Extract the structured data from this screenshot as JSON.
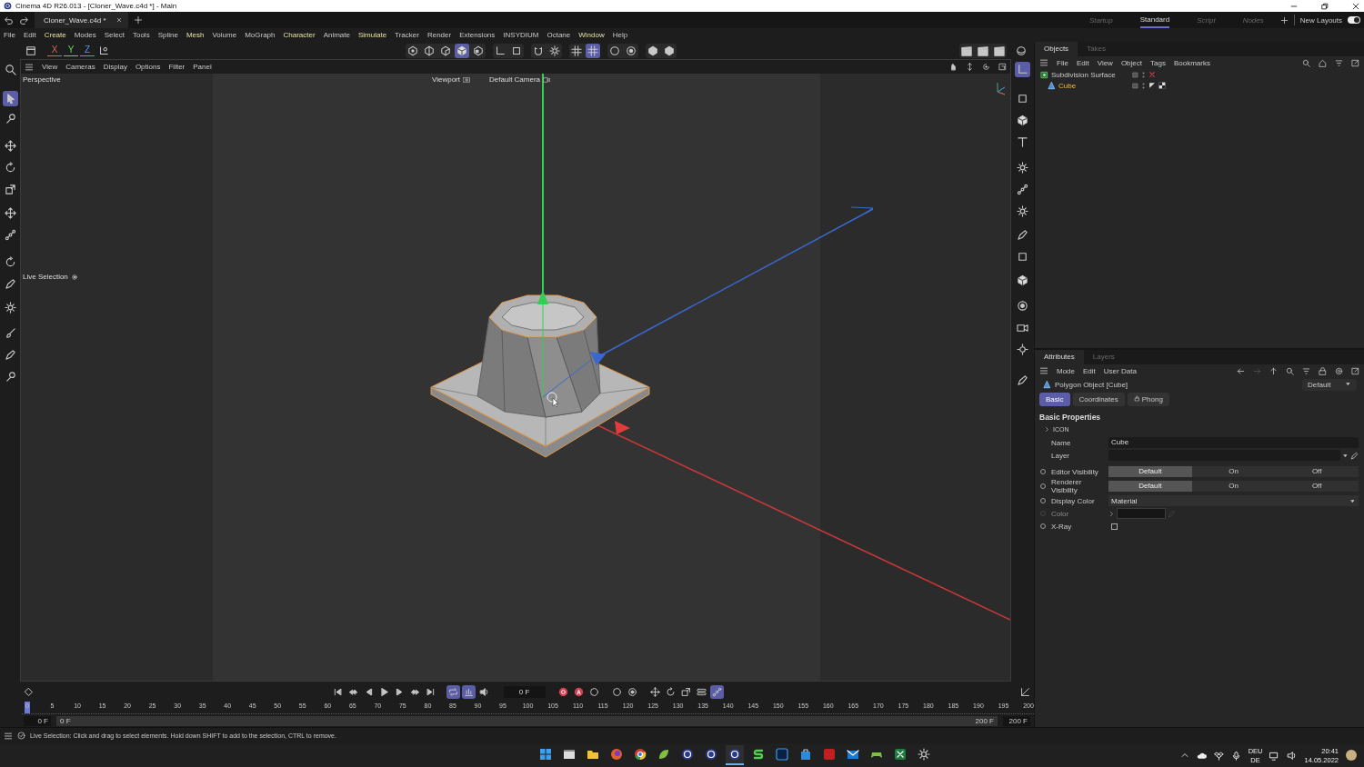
{
  "window": {
    "title": "Cinema 4D R26.013 - [Cloner_Wave.c4d *] - Main"
  },
  "document_tab": {
    "label": "Cloner_Wave.c4d *"
  },
  "layouts": [
    {
      "label": "Startup",
      "selected": false
    },
    {
      "label": "Standard",
      "selected": true
    },
    {
      "label": "Script",
      "selected": false
    },
    {
      "label": "Nodes",
      "selected": false
    }
  ],
  "new_layouts": {
    "label": "New Layouts",
    "on": true
  },
  "menu": [
    {
      "label": "File",
      "highlight": false
    },
    {
      "label": "Edit",
      "highlight": false
    },
    {
      "label": "Create",
      "highlight": true
    },
    {
      "label": "Modes",
      "highlight": false
    },
    {
      "label": "Select",
      "highlight": false
    },
    {
      "label": "Tools",
      "highlight": false
    },
    {
      "label": "Spline",
      "highlight": false
    },
    {
      "label": "Mesh",
      "highlight": true
    },
    {
      "label": "Volume",
      "highlight": false
    },
    {
      "label": "MoGraph",
      "highlight": false
    },
    {
      "label": "Character",
      "highlight": true
    },
    {
      "label": "Animate",
      "highlight": false
    },
    {
      "label": "Simulate",
      "highlight": true
    },
    {
      "label": "Tracker",
      "highlight": false
    },
    {
      "label": "Render",
      "highlight": false
    },
    {
      "label": "Extensions",
      "highlight": false
    },
    {
      "label": "INSYDIUM",
      "highlight": false
    },
    {
      "label": "Octane",
      "highlight": false
    },
    {
      "label": "Window",
      "highlight": true
    },
    {
      "label": "Help",
      "highlight": false
    }
  ],
  "axis_lock": [
    {
      "label": "X",
      "color": "#e06060"
    },
    {
      "label": "Y",
      "color": "#60d060"
    },
    {
      "label": "Z",
      "color": "#6090e8"
    }
  ],
  "toolbar": [
    {
      "kind": "point",
      "selected": false
    },
    {
      "kind": "edge",
      "selected": false
    },
    {
      "kind": "poly",
      "selected": false
    },
    {
      "kind": "cube",
      "selected": true
    },
    {
      "kind": "checker",
      "selected": false
    },
    {
      "kind": "corner",
      "selected": false
    },
    {
      "kind": "square",
      "selected": false
    },
    {
      "kind": "magnet",
      "selected": false
    },
    {
      "kind": "gear",
      "selected": false
    },
    {
      "kind": "grid",
      "selected": false
    },
    {
      "kind": "grid",
      "selected": true
    },
    {
      "kind": "dot",
      "selected": false
    },
    {
      "kind": "target",
      "selected": false
    },
    {
      "kind": "hexagon",
      "selected": false
    },
    {
      "kind": "hexagon",
      "selected": false
    }
  ],
  "left_tools": [
    {
      "kind": "search",
      "selected": false
    },
    {
      "kind": "cursor",
      "selected": true
    },
    {
      "kind": "tweak",
      "selected": false
    },
    {
      "kind": "move",
      "selected": false
    },
    {
      "kind": "rotate",
      "selected": false
    },
    {
      "kind": "scale",
      "selected": false
    },
    {
      "kind": "move",
      "selected": false
    },
    {
      "kind": "nodes",
      "selected": false
    },
    {
      "kind": "rotate",
      "selected": false
    },
    {
      "kind": "pen",
      "selected": false
    },
    {
      "kind": "gear",
      "selected": false
    },
    {
      "kind": "brush",
      "selected": false
    },
    {
      "kind": "pen",
      "selected": false
    },
    {
      "kind": "tweak",
      "selected": false
    }
  ],
  "right_palette": [
    {
      "kind": "corner",
      "selected": true
    },
    {
      "kind": "square",
      "selected": false
    },
    {
      "kind": "cube",
      "selected": false
    },
    {
      "kind": "text",
      "selected": false
    },
    {
      "kind": "gear",
      "selected": false
    },
    {
      "kind": "nodes",
      "selected": false
    },
    {
      "kind": "gear",
      "selected": false
    },
    {
      "kind": "pen",
      "selected": false
    },
    {
      "kind": "square",
      "selected": false
    },
    {
      "kind": "cube",
      "selected": false
    },
    {
      "kind": "target",
      "selected": false
    },
    {
      "kind": "camera",
      "selected": false
    },
    {
      "kind": "sun",
      "selected": false
    },
    {
      "kind": "pen",
      "selected": false
    }
  ],
  "viewport": {
    "menu": [
      "View",
      "Cameras",
      "Display",
      "Options",
      "Filter",
      "Panel"
    ],
    "view_name": "Perspective",
    "viewport_label": "Viewport",
    "camera": "Default Camera",
    "tool_label": "Live Selection"
  },
  "objects": {
    "tabs": [
      {
        "label": "Objects",
        "selected": true
      },
      {
        "label": "Takes",
        "selected": false
      }
    ],
    "menu": [
      "File",
      "Edit",
      "View",
      "Object",
      "Tags",
      "Bookmarks"
    ],
    "items": [
      {
        "name": "Subdivision Surface",
        "kind": "generator",
        "enabled": false,
        "selected": false,
        "children": [
          {
            "name": "Cube",
            "kind": "polygon",
            "enabled": true,
            "selected": true
          }
        ]
      }
    ]
  },
  "attributes": {
    "tabs": [
      {
        "label": "Attributes",
        "selected": true
      },
      {
        "label": "Layers",
        "selected": false
      }
    ],
    "menu": [
      "Mode",
      "Edit",
      "User Data"
    ],
    "object_title": "Polygon Object [Cube]",
    "preset": "Default",
    "subtabs": [
      {
        "label": "Basic",
        "selected": true
      },
      {
        "label": "Coordinates",
        "selected": false
      },
      {
        "label": "Phong",
        "selected": false
      }
    ],
    "section": "Basic Properties",
    "group": {
      "label": "ICON",
      "expanded": false
    },
    "fields": [
      {
        "label": "Name",
        "kind": "text",
        "value": "Cube",
        "animatable": false,
        "disabled": false
      },
      {
        "label": "Layer",
        "kind": "link",
        "animatable": false,
        "disabled": false
      },
      {
        "label": "Editor Visibility",
        "kind": "segmented",
        "animatable": true,
        "disabled": false,
        "options": [
          {
            "label": "Default",
            "selected": true
          },
          {
            "label": "On",
            "selected": false
          },
          {
            "label": "Off",
            "selected": false
          }
        ]
      },
      {
        "label": "Renderer Visibility",
        "kind": "segmented",
        "animatable": true,
        "disabled": false,
        "options": [
          {
            "label": "Default",
            "selected": true
          },
          {
            "label": "On",
            "selected": false
          },
          {
            "label": "Off",
            "selected": false
          }
        ]
      },
      {
        "label": "Display Color",
        "kind": "dropdown",
        "value": "Material",
        "animatable": true,
        "disabled": false
      },
      {
        "label": "Color",
        "kind": "color",
        "animatable": true,
        "disabled": true
      },
      {
        "label": "X-Ray",
        "kind": "checkbox",
        "checked": false,
        "animatable": true,
        "disabled": false
      }
    ]
  },
  "timeline": {
    "current_frame": "0 F",
    "playhead": {
      "level": 0
    },
    "buttons": [
      {
        "kind": "first",
        "selected": false
      },
      {
        "kind": "prevkey",
        "selected": false
      },
      {
        "kind": "prev",
        "selected": false
      },
      {
        "kind": "play",
        "selected": false
      },
      {
        "kind": "next",
        "selected": false
      },
      {
        "kind": "nextkey",
        "selected": false
      },
      {
        "kind": "last",
        "selected": false
      },
      {
        "kind": "loop",
        "selected": true
      },
      {
        "kind": "auto",
        "selected": true
      },
      {
        "kind": "sound",
        "selected": false
      }
    ],
    "key_buttons": [
      {
        "kind": "record",
        "selected": false
      },
      {
        "kind": "autokey",
        "selected": false
      },
      {
        "kind": "dot",
        "selected": false
      },
      {
        "kind": "dot",
        "selected": false
      },
      {
        "kind": "target",
        "selected": false
      },
      {
        "kind": "move",
        "selected": false
      },
      {
        "kind": "rotate",
        "selected": false
      },
      {
        "kind": "scale",
        "selected": false
      },
      {
        "kind": "toggle",
        "selected": false
      },
      {
        "kind": "nodes",
        "selected": true
      }
    ],
    "ruler_labels": [
      "0",
      "5",
      "10",
      "15",
      "20",
      "25",
      "30",
      "35",
      "40",
      "45",
      "50",
      "55",
      "60",
      "65",
      "70",
      "75",
      "80",
      "85",
      "90",
      "95",
      "100",
      "105",
      "110",
      "115",
      "120",
      "125",
      "130",
      "135",
      "140",
      "145",
      "150",
      "155",
      "160",
      "165",
      "170",
      "175",
      "180",
      "185",
      "190",
      "195",
      "200"
    ],
    "start": "0 F",
    "range_start": "0 F",
    "range_end": "200 F",
    "end": "200 F"
  },
  "status": "Live Selection: Click and drag to select elements. Hold down SHIFT to add to the selection, CTRL to remove.",
  "taskbar": {
    "apps": [
      {
        "kind": "start",
        "selected": false
      },
      {
        "kind": "window",
        "selected": false
      },
      {
        "kind": "folder",
        "selected": false
      },
      {
        "kind": "fox",
        "selected": false
      },
      {
        "kind": "chrome",
        "selected": false
      },
      {
        "kind": "leaf",
        "selected": false
      },
      {
        "kind": "ring",
        "selected": false
      },
      {
        "kind": "ring",
        "selected": false
      },
      {
        "kind": "ring",
        "selected": true
      },
      {
        "kind": "s",
        "selected": false
      },
      {
        "kind": "ps",
        "selected": false
      },
      {
        "kind": "store",
        "selected": false
      },
      {
        "kind": "acro",
        "selected": false
      },
      {
        "kind": "mail",
        "selected": false
      },
      {
        "kind": "game",
        "selected": false
      },
      {
        "kind": "excel",
        "selected": false
      },
      {
        "kind": "gear",
        "selected": false
      }
    ],
    "language": [
      "DEU",
      "DE"
    ],
    "time": "20:41",
    "date": "14.05.2022"
  }
}
